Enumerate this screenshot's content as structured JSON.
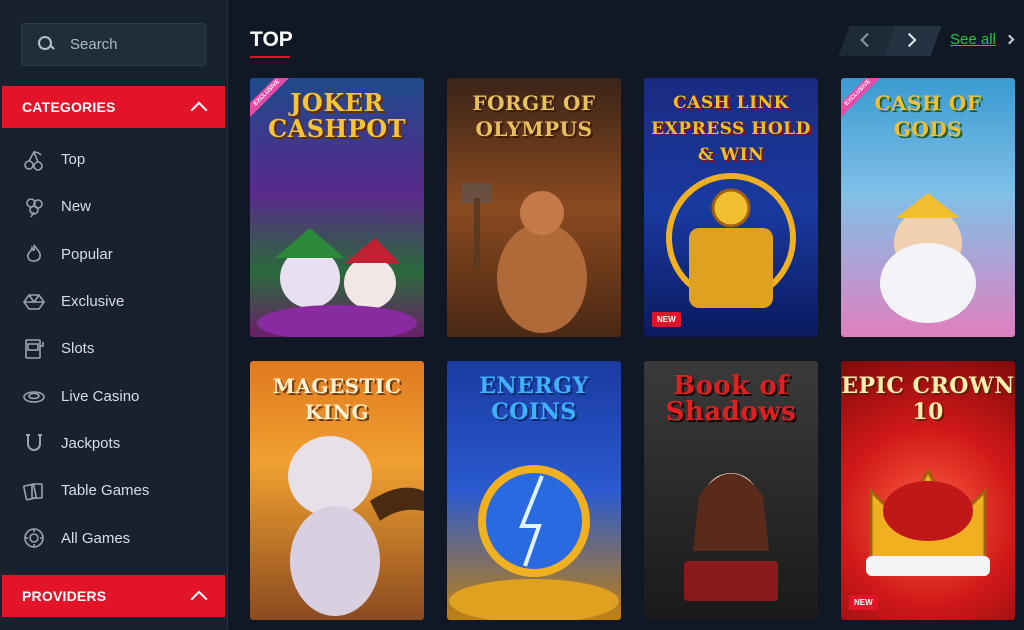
{
  "search": {
    "placeholder": "Search"
  },
  "categories": {
    "header": "CATEGORIES",
    "items": [
      {
        "label": "Top",
        "icon": "cherries-icon"
      },
      {
        "label": "New",
        "icon": "clover-icon"
      },
      {
        "label": "Popular",
        "icon": "flame-icon"
      },
      {
        "label": "Exclusive",
        "icon": "diamond-icon"
      },
      {
        "label": "Slots",
        "icon": "slot-machine-icon"
      },
      {
        "label": "Live Casino",
        "icon": "roulette-icon"
      },
      {
        "label": "Jackpots",
        "icon": "horseshoe-icon"
      },
      {
        "label": "Table Games",
        "icon": "cards-icon"
      },
      {
        "label": "All Games",
        "icon": "chip-icon"
      }
    ]
  },
  "providers": {
    "header": "PROVIDERS"
  },
  "section": {
    "title": "TOP",
    "see_all": "See all"
  },
  "games": [
    {
      "title": "JOKER CASHPOT",
      "badge": "EXCLUSIVE"
    },
    {
      "title": "FORGE OF OLYMPUS"
    },
    {
      "title": "CASH LINK EXPRESS HOLD & WIN",
      "badge": "NEW"
    },
    {
      "title": "CASH OF GODS",
      "badge": "EXCLUSIVE"
    },
    {
      "title": "MAGESTIC KING"
    },
    {
      "title": "ENERGY COINS"
    },
    {
      "title": "Book of Shadows"
    },
    {
      "title": "EPIC CROWN 10",
      "badge": "NEW"
    }
  ],
  "colors": {
    "accent": "#e3142a",
    "link": "#1ec93c",
    "sidebar": "#18222f",
    "background": "#0f1824"
  }
}
